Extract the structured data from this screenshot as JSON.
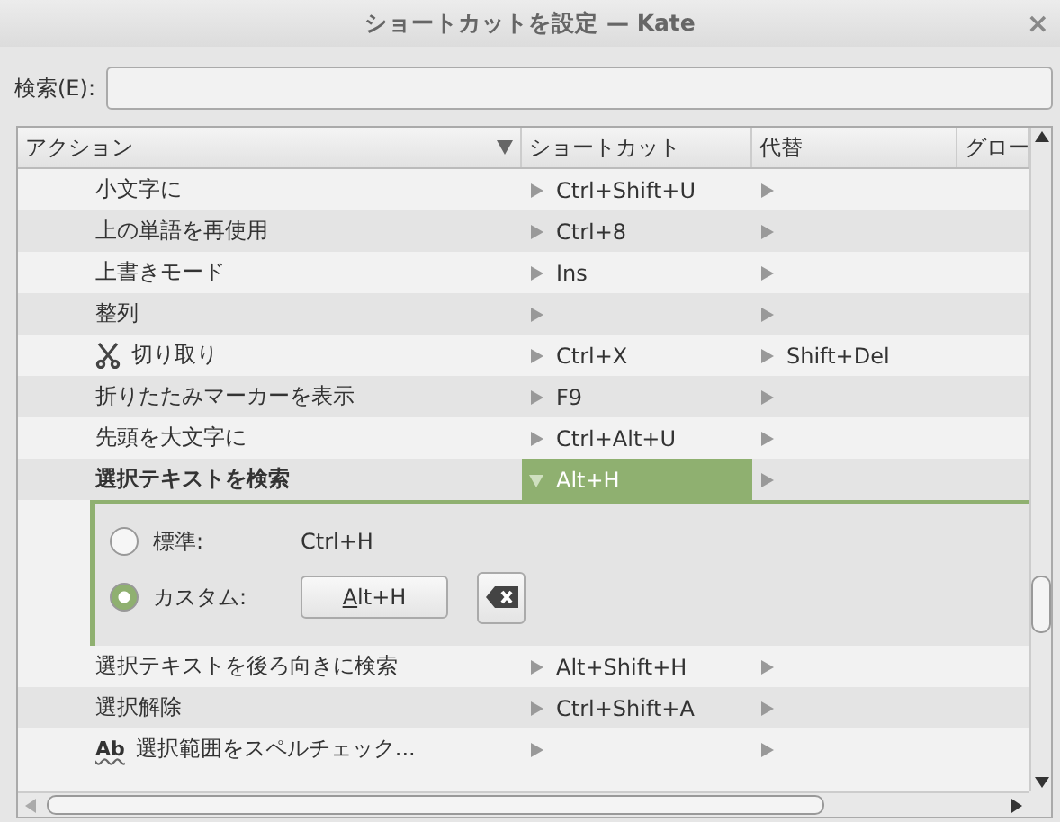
{
  "window": {
    "title": "ショートカットを設定 — Kate",
    "close": "×"
  },
  "search": {
    "label": "検索(E):"
  },
  "table": {
    "columns": [
      "アクション",
      "ショートカット",
      "代替",
      "グロー"
    ],
    "rows": [
      {
        "action": "小文字に",
        "shortcut": "Ctrl+Shift+U",
        "alternate": "",
        "selected": false
      },
      {
        "action": "上の単語を再使用",
        "shortcut": "Ctrl+8",
        "alternate": "",
        "selected": false
      },
      {
        "action": "上書きモード",
        "shortcut": "Ins",
        "alternate": "",
        "selected": false
      },
      {
        "action": "整列",
        "shortcut": "",
        "alternate": "",
        "selected": false
      },
      {
        "action": "切り取り",
        "kind": "scissors",
        "shortcut": "Ctrl+X",
        "alternate": "Shift+Del",
        "selected": false
      },
      {
        "action": "折りたたみマーカーを表示",
        "shortcut": "F9",
        "alternate": "",
        "selected": false
      },
      {
        "action": "先頭を大文字に",
        "shortcut": "Ctrl+Alt+U",
        "alternate": "",
        "selected": false
      },
      {
        "action": "選択テキストを検索",
        "shortcut": "Alt+H",
        "alternate": "",
        "selected": true,
        "editor": {
          "options": [
            {
              "label": "標準:",
              "value": "Ctrl+H",
              "kind": "text",
              "selected": false
            },
            {
              "label": "カスタム:",
              "value": "Alt+H",
              "kind": "button",
              "selected": true
            }
          ]
        }
      },
      {
        "action": "選択テキストを後ろ向きに検索",
        "shortcut": "Alt+Shift+H",
        "alternate": "",
        "selected": false
      },
      {
        "action": "選択解除",
        "shortcut": "Ctrl+Shift+A",
        "alternate": "",
        "selected": false
      },
      {
        "action": "選択範囲をスペルチェック...",
        "kind": "spellcheck",
        "icon_text": "Ab",
        "shortcut": "",
        "alternate": "",
        "selected": false
      }
    ]
  }
}
